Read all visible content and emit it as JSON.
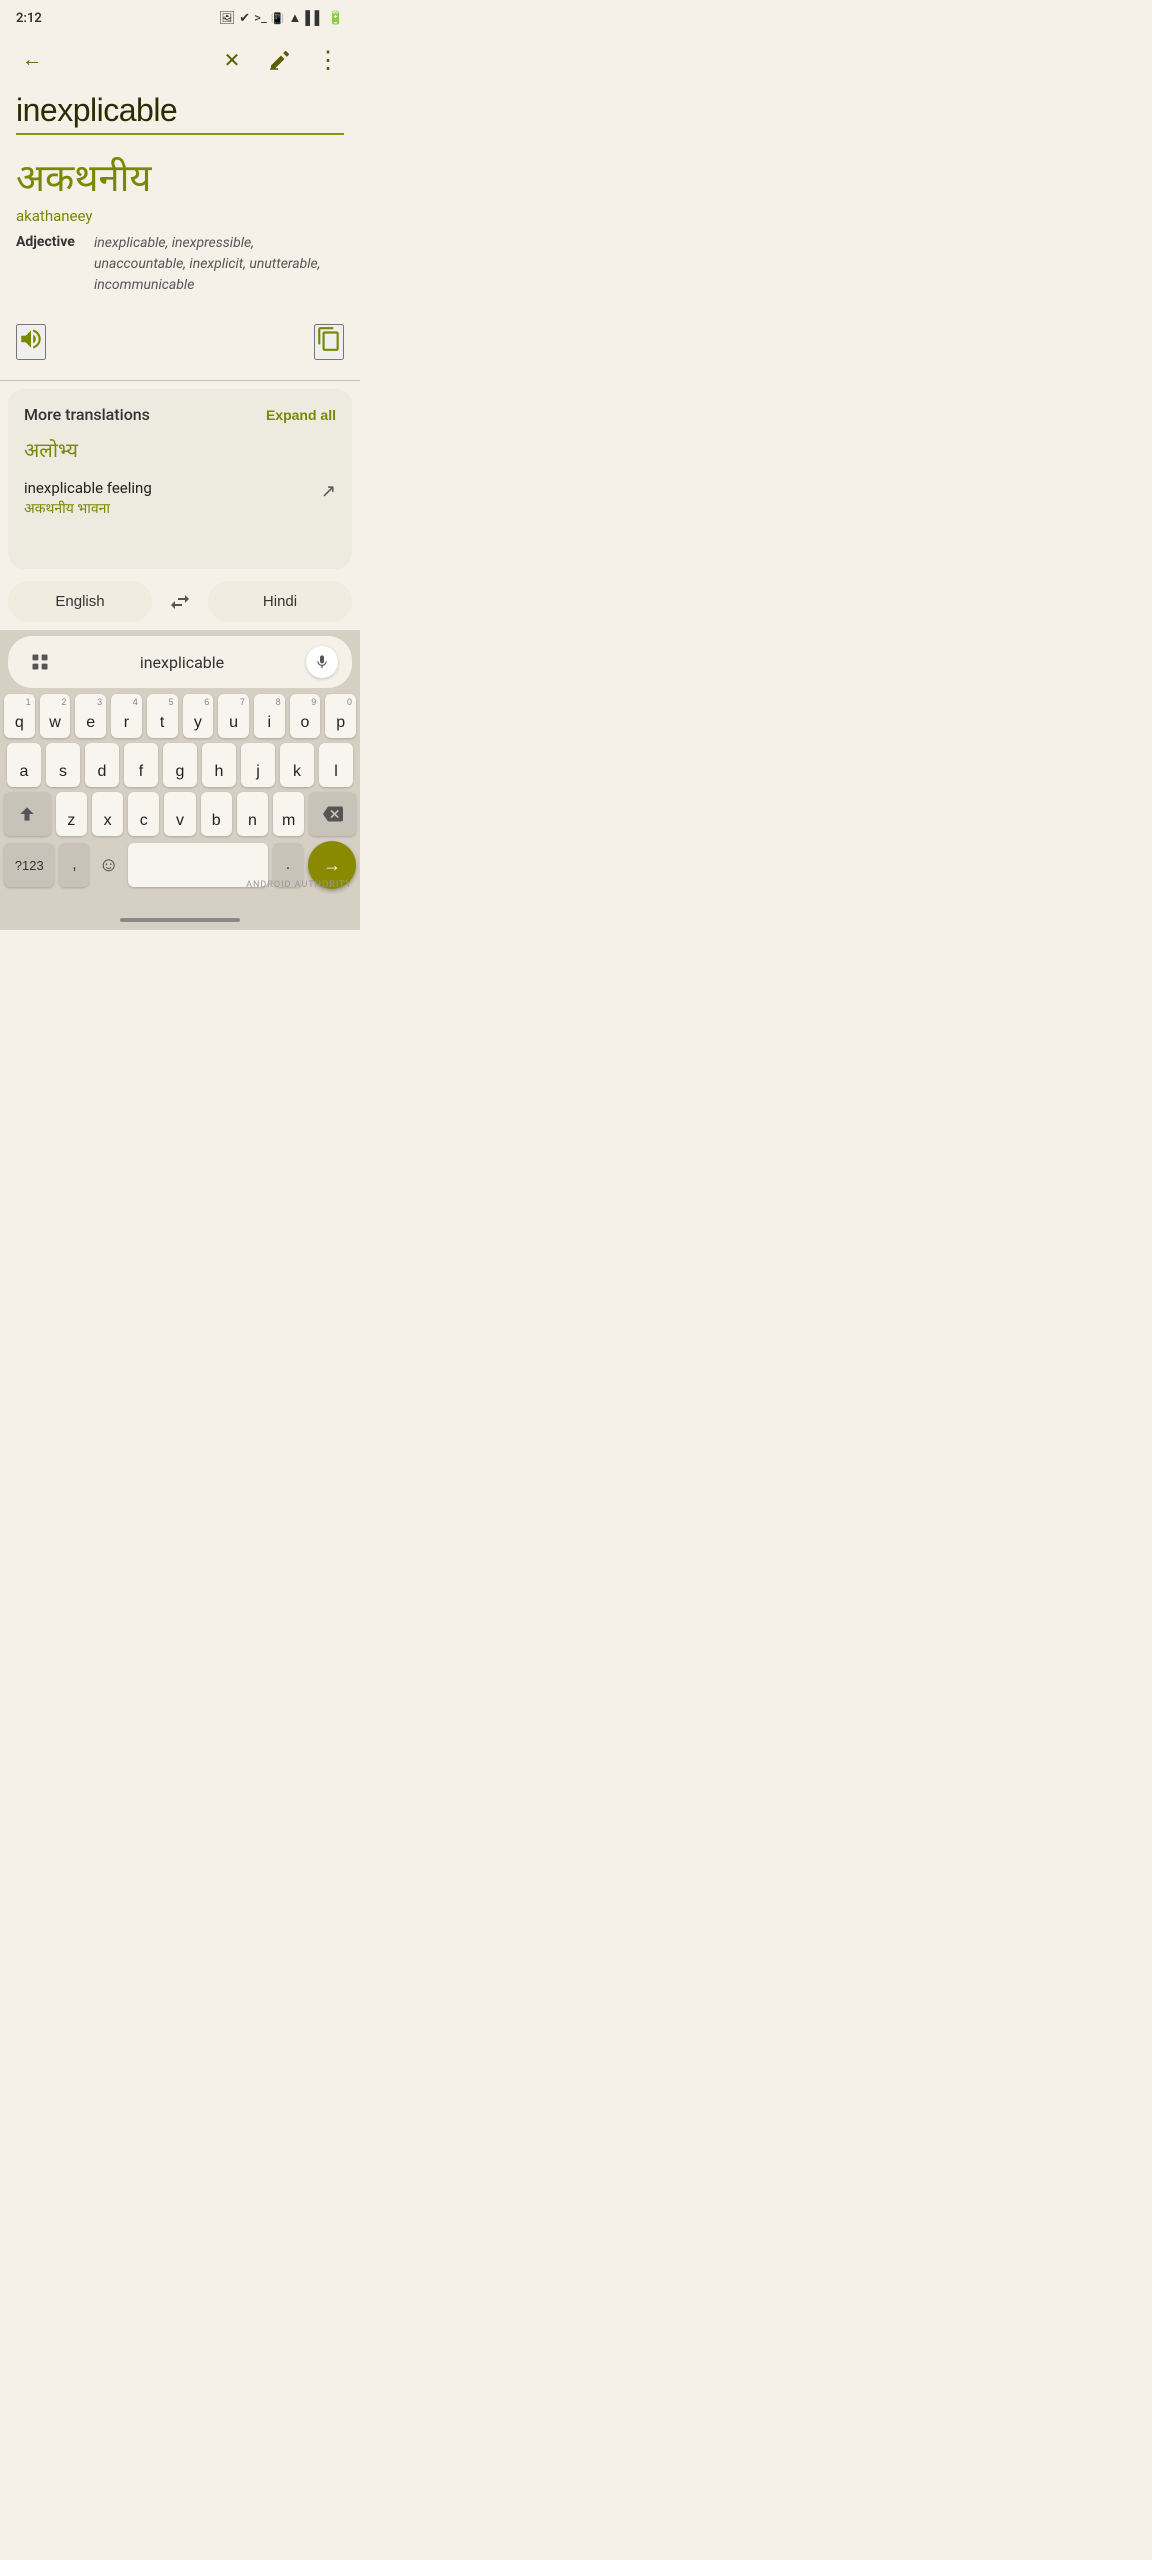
{
  "status": {
    "time": "2:12",
    "battery": "🔋",
    "signal": "📶"
  },
  "toolbar": {
    "back_label": "←",
    "close_label": "✕",
    "annotate_label": "✏",
    "more_label": "⋮"
  },
  "input": {
    "value": "inexplicable",
    "placeholder": "inexplicable"
  },
  "translation": {
    "hindi_word": "अकथनीय",
    "transliteration": "akathaneey",
    "pos": "Adjective",
    "synonyms": "inexplicable, inexpressible, unaccountable, inexplicit, unutterable, incommunicable"
  },
  "more_translations": {
    "title": "More translations",
    "expand_all": "Expand all",
    "hindi_alt": "अलोभ्य",
    "phrase_en": "inexplicable feeling",
    "phrase_hi": "अकथनीय भावना"
  },
  "lang_switch": {
    "source": "English",
    "target": "Hindi",
    "swap_icon": "⇄"
  },
  "keyboard": {
    "input_text": "inexplicable",
    "rows": [
      [
        "q",
        "w",
        "e",
        "r",
        "t",
        "y",
        "u",
        "i",
        "o",
        "p"
      ],
      [
        "a",
        "s",
        "d",
        "f",
        "g",
        "h",
        "j",
        "k",
        "l"
      ],
      [
        "z",
        "x",
        "c",
        "v",
        "b",
        "n",
        "m"
      ]
    ],
    "number_hints": [
      "1",
      "2",
      "3",
      "4",
      "5",
      "6",
      "7",
      "8",
      "9",
      "0"
    ],
    "bottom": {
      "num_label": "?123",
      "comma": ",",
      "period": ".",
      "enter_icon": "→"
    }
  },
  "attribution": "ANDROID AUTHORITY"
}
